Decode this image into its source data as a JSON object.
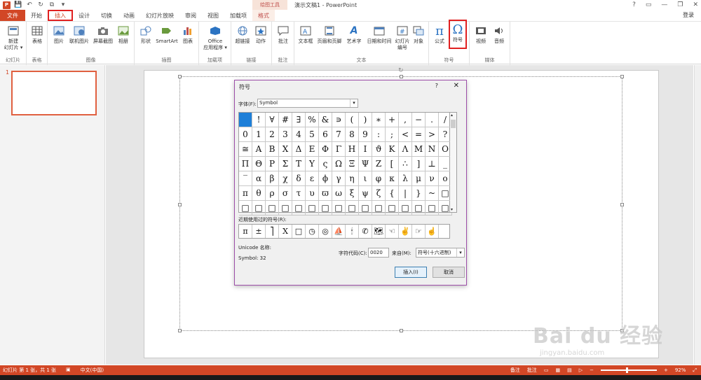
{
  "app": {
    "title": "演示文稿1 - PowerPoint",
    "drawing_tools": "绘图工具",
    "login": "登录",
    "window_buttons": [
      "?",
      "▭",
      "—",
      "❐",
      "✕"
    ]
  },
  "tabs": [
    {
      "label": "文件",
      "kind": "file"
    },
    {
      "label": "开始"
    },
    {
      "label": "插入",
      "kind": "active"
    },
    {
      "label": "设计"
    },
    {
      "label": "切换"
    },
    {
      "label": "动画"
    },
    {
      "label": "幻灯片放映"
    },
    {
      "label": "审阅"
    },
    {
      "label": "视图"
    },
    {
      "label": "加载项"
    },
    {
      "label": "格式",
      "kind": "format"
    }
  ],
  "ribbon": {
    "groups": {
      "slides": "幻灯片",
      "tables": "表格",
      "images": "图像",
      "illustrations": "插图",
      "addins": "加载项",
      "links": "链接",
      "comments": "批注",
      "text": "文本",
      "symbols": "符号",
      "media": "媒体"
    },
    "buttons": {
      "new_slide": "新建\n幻灯片 ▾",
      "table": "表格",
      "picture": "图片",
      "online_picture": "联机图片",
      "screenshot": "屏幕截图",
      "album": "相册",
      "shapes": "形状",
      "smartart": "SmartArt",
      "chart": "图表",
      "office_apps": "Office\n应用程序 ▾",
      "hyperlink": "超链接",
      "action": "动作",
      "comment": "批注",
      "textbox": "文本框",
      "header_footer": "页眉和页脚",
      "wordart": "艺术字",
      "datetime": "日期和时间",
      "slide_number": "幻灯片\n编号",
      "object": "对象",
      "equation": "公式",
      "symbol": "符号",
      "video": "视频",
      "audio": "音频"
    }
  },
  "thumbnails": {
    "slide_number": "1"
  },
  "status": {
    "slide_info": "幻灯片 第 1 张，共 1 张",
    "language": "中文(中国)",
    "notes": "备注",
    "comments": "批注",
    "zoom": "92%",
    "zoom_fraction": 0.46
  },
  "watermark": {
    "main": "Bai du 经验",
    "url": "jingyan.baidu.com"
  },
  "dialog": {
    "title": "符号",
    "help": "?",
    "close": "✕",
    "font_label": "字体(F):",
    "font_value": "Symbol",
    "grid_rows": [
      [
        " ",
        "!",
        "∀",
        "#",
        "∃",
        "%",
        "&",
        "∍",
        "(",
        ")",
        "∗",
        "+",
        ",",
        "−",
        ".",
        "/"
      ],
      [
        "0",
        "1",
        "2",
        "3",
        "4",
        "5",
        "6",
        "7",
        "8",
        "9",
        ":",
        ";",
        "<",
        "=",
        ">",
        "?"
      ],
      [
        "≅",
        "Α",
        "Β",
        "Χ",
        "Δ",
        "Ε",
        "Φ",
        "Γ",
        "Η",
        "Ι",
        "ϑ",
        "Κ",
        "Λ",
        "Μ",
        "Ν",
        "Ο"
      ],
      [
        "Π",
        "Θ",
        "Ρ",
        "Σ",
        "Τ",
        "Υ",
        "ς",
        "Ω",
        "Ξ",
        "Ψ",
        "Ζ",
        "[",
        "∴",
        "]",
        "⊥",
        "_"
      ],
      [
        "‾",
        "α",
        "β",
        "χ",
        "δ",
        "ε",
        "ϕ",
        "γ",
        "η",
        "ι",
        "φ",
        "κ",
        "λ",
        "μ",
        "ν",
        "ο"
      ],
      [
        "π",
        "θ",
        "ρ",
        "σ",
        "τ",
        "υ",
        "ϖ",
        "ω",
        "ξ",
        "ψ",
        "ζ",
        "{",
        "|",
        "}",
        "~",
        "□"
      ],
      [
        "□",
        "□",
        "□",
        "□",
        "□",
        "□",
        "□",
        "□",
        "□",
        "□",
        "□",
        "□",
        "□",
        "□",
        "□",
        "□"
      ]
    ],
    "recent_label": "近期使用过的符号(R):",
    "recent": [
      "π",
      "±",
      "⎤",
      "X",
      "□",
      "◷",
      "◎",
      "⛵",
      "🕯",
      "✆",
      "🗺",
      "☜",
      "✌",
      "☞",
      "☝"
    ],
    "unicode_name_label": "Unicode 名称:",
    "symbol_code": "Symbol: 32",
    "charcode_label": "字符代码(C):",
    "charcode_value": "0020",
    "from_label": "来自(M):",
    "from_value": "符号(十六进制)",
    "insert": "插入(I)",
    "cancel": "取消"
  }
}
